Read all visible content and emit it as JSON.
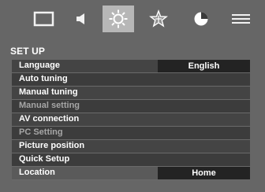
{
  "icons": {
    "tab_1": "display-icon",
    "tab_2": "speaker-icon",
    "tab_3": "setup-gear-icon",
    "tab_4": "features-star-icon",
    "tab_5": "timer-clock-icon",
    "tab_6": "menu-lines-icon"
  },
  "section": {
    "title": "SET UP"
  },
  "menu": {
    "items": [
      {
        "label": "Language",
        "value": "English"
      },
      {
        "label": "Auto tuning"
      },
      {
        "label": "Manual tuning"
      },
      {
        "label": "Manual setting"
      },
      {
        "label": "AV connection"
      },
      {
        "label": "PC Setting"
      },
      {
        "label": "Picture position"
      },
      {
        "label": "Quick Setup"
      },
      {
        "label": "Location",
        "value": "Home"
      }
    ]
  },
  "colors": {
    "background": "#666666",
    "selected_tab": "#b7b7b7",
    "value_box": "#232323",
    "disabled_text": "#a6a6a6"
  }
}
